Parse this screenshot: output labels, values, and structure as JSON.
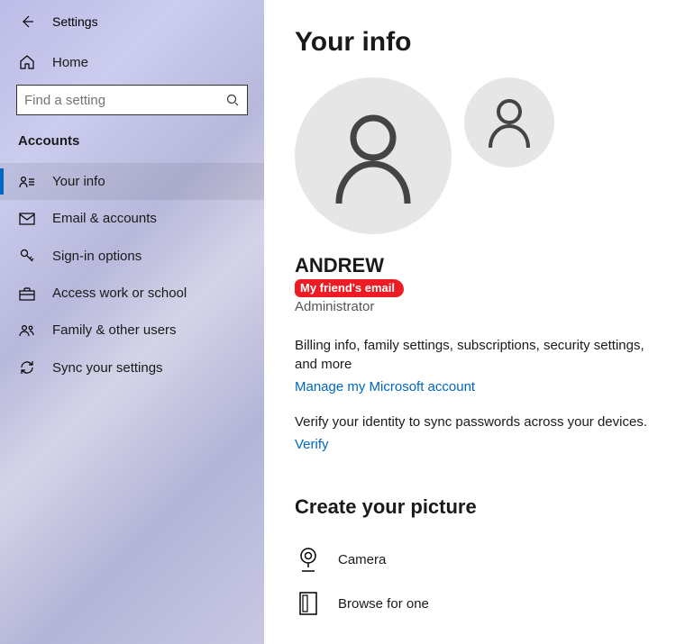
{
  "header": {
    "title": "Settings"
  },
  "home_label": "Home",
  "search": {
    "placeholder": "Find a setting"
  },
  "category": "Accounts",
  "nav": [
    {
      "label": "Your info"
    },
    {
      "label": "Email & accounts"
    },
    {
      "label": "Sign-in options"
    },
    {
      "label": "Access work or school"
    },
    {
      "label": "Family & other users"
    },
    {
      "label": "Sync your settings"
    }
  ],
  "page_title": "Your info",
  "user": {
    "name": "ANDREW",
    "redacted_email_label": "My friend's email",
    "role": "Administrator"
  },
  "billing_desc": "Billing info, family settings, subscriptions, security settings, and more",
  "manage_link": "Manage my Microsoft account",
  "verify_desc": "Verify your identity to sync passwords across your devices.",
  "verify_link": "Verify",
  "picture_heading": "Create your picture",
  "picture_options": {
    "camera": "Camera",
    "browse": "Browse for one"
  }
}
